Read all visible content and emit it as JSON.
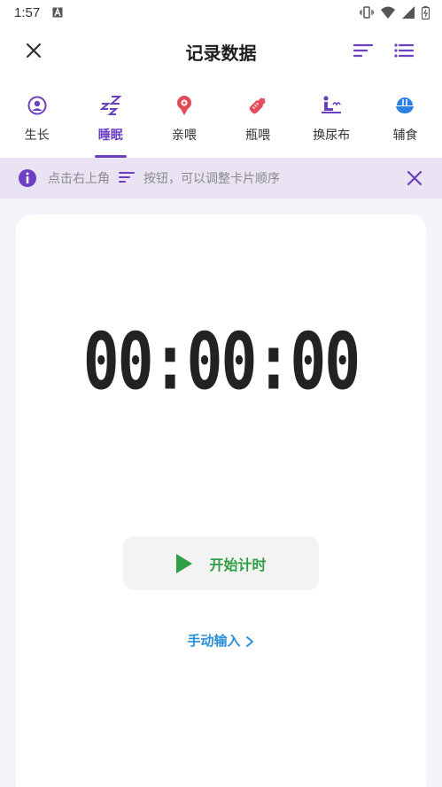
{
  "status_bar": {
    "time": "1:57",
    "left_icons": [
      "font-a-icon"
    ],
    "right_icons": [
      "vibrate-icon",
      "wifi-icon",
      "signal-icon",
      "battery-icon"
    ]
  },
  "app_bar": {
    "title": "记录数据",
    "close_icon": "close-icon",
    "sort_icon": "sort-icon",
    "list_icon": "list-icon",
    "accent_color": "#6b3fc0"
  },
  "tabs": [
    {
      "label": "生长",
      "icon": "person-circle-icon",
      "active": false,
      "color": "#6b3fc0"
    },
    {
      "label": "睡眠",
      "icon": "sleep-zzz-icon",
      "active": true,
      "color": "#6b3fc0"
    },
    {
      "label": "亲喂",
      "icon": "breastfeed-icon",
      "active": false,
      "color": "#e34a5a"
    },
    {
      "label": "瓶喂",
      "icon": "baby-bottle-icon",
      "active": false,
      "color": "#e34a5a"
    },
    {
      "label": "换尿布",
      "icon": "diaper-change-icon",
      "active": false,
      "color": "#6b3fc0"
    },
    {
      "label": "辅食",
      "icon": "bowl-icon",
      "active": false,
      "color": "#2f7fe0"
    }
  ],
  "tip": {
    "text_before": "点击右上角",
    "text_after": "按钮，可以调整卡片顺序",
    "info_icon": "info-icon",
    "sort_icon": "sort-icon",
    "close_icon": "close-icon"
  },
  "timer_card": {
    "time": "00:00:00",
    "start_label": "开始计时",
    "start_icon": "play-icon",
    "start_color": "#2e9f44",
    "manual_label": "手动输入",
    "manual_icon": "chevron-right-icon",
    "manual_color": "#2b8fd8"
  }
}
